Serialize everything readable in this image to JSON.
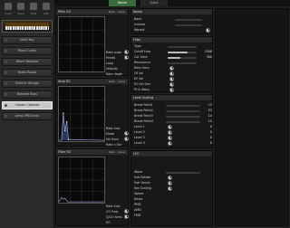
{
  "toolbar": [
    {
      "icon": "folder-icon",
      "label": "Load"
    },
    {
      "icon": "disk-icon",
      "label": "Save"
    },
    {
      "icon": "edit-icon",
      "label": "Edit"
    },
    {
      "icon": "info-icon",
      "label": "Info"
    }
  ],
  "patches": [
    {
      "label": "Multi Key",
      "active": false
    },
    {
      "label": "Piano Cards",
      "active": false
    },
    {
      "label": "Warm Relaxed",
      "active": false
    },
    {
      "label": "Brass Roads",
      "active": false
    },
    {
      "label": "Electric Strings",
      "active": false
    },
    {
      "label": "Blessed Bass",
      "active": false
    },
    {
      "label": "Classic Clavinet",
      "active": true
    },
    {
      "label": "Jarbo JPBComm",
      "active": false
    }
  ],
  "tabs": [
    {
      "label": "Name",
      "on": true
    },
    {
      "label": "Quick",
      "on": false
    }
  ],
  "pitch_eg": {
    "title": "Pitch EG",
    "rate_label": "Rate",
    "level_label": "Level",
    "params": [
      "Rate scale",
      "Feedb",
      "Loop",
      "Velocity",
      "Rate depth"
    ]
  },
  "amp_eg": {
    "title": "Amp EG",
    "rate_label": "Rate",
    "level_label": "Level",
    "params": [
      "Rate Scal",
      "Mode",
      "Vel Sens",
      "Rate x Dur"
    ]
  },
  "filter_eg": {
    "title": "Filter EG",
    "rate_label": "Rate",
    "level_label": "Level",
    "params": [
      "Rate Scal",
      "CO Freq",
      "Q/CO Sens",
      "EG"
    ]
  },
  "name_section": {
    "title": "Name",
    "rows": [
      {
        "label": "Bank",
        "value": ""
      },
      {
        "label": "Inverse",
        "value": ""
      },
      {
        "label": "Wave#",
        "value": ""
      }
    ]
  },
  "filter_section": {
    "title": "Filter",
    "rows": [
      {
        "label": "Type",
        "value": ""
      },
      {
        "label": "Cutoff Freq",
        "value": "2508"
      },
      {
        "label": "Cut Sens",
        "value": "300"
      },
      {
        "label": "Resonance",
        "value": ""
      },
      {
        "label": "Resn Sens",
        "value": ""
      },
      {
        "label": "LR Vel",
        "value": ""
      },
      {
        "label": "KY Vel",
        "value": ""
      },
      {
        "label": "EG Vel Sen",
        "value": ""
      },
      {
        "label": "Pt & Wavs",
        "value": ""
      }
    ]
  },
  "level_section": {
    "title": "Level Scaling",
    "rows": [
      {
        "label": "Break Point1",
        "value": "C3"
      },
      {
        "label": "Break Point2",
        "value": "E3"
      },
      {
        "label": "Break Point3",
        "value": "C4"
      },
      {
        "label": "Break Point4",
        "value": "C5"
      },
      {
        "label": "Level 1",
        "value": "0"
      },
      {
        "label": "Level 2",
        "value": "0"
      },
      {
        "label": "Level 3",
        "value": "0"
      },
      {
        "label": "Level 4",
        "value": "0"
      }
    ]
  },
  "lfo_section": {
    "title": "LFO",
    "rows": [
      {
        "label": "Wave",
        "value": ""
      },
      {
        "label": "Sub Rotate",
        "value": ""
      },
      {
        "label": "Sub Vector",
        "value": ""
      },
      {
        "label": "Key Scaling",
        "value": ""
      },
      {
        "label": "Speed",
        "value": ""
      },
      {
        "label": "Delay",
        "value": ""
      },
      {
        "label": "PMD",
        "value": ""
      },
      {
        "label": "AMD",
        "value": ""
      },
      {
        "label": "FMD",
        "value": ""
      }
    ]
  },
  "colors": {
    "accent": "#3a6b3a",
    "active_patch": "#c8c8c8",
    "graph_line": "#9aa8d8"
  }
}
